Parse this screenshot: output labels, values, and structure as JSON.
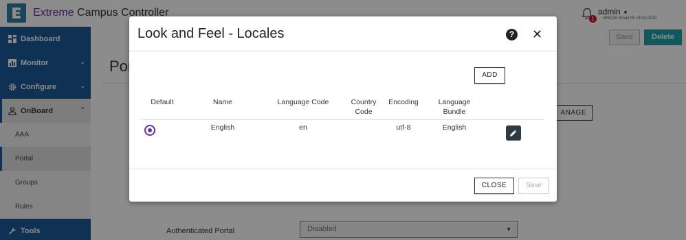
{
  "header": {
    "app_title_prefix": "Extreme",
    "app_title_suffix": " Campus Controller",
    "notification_count": "1",
    "user_name": "admin",
    "user_sub": "VE6120 Small 05.16.02.0020"
  },
  "sidebar": {
    "items": [
      {
        "label": "Dashboard"
      },
      {
        "label": "Monitor"
      },
      {
        "label": "Configure"
      },
      {
        "label": "OnBoard"
      },
      {
        "label": "AAA"
      },
      {
        "label": "Portal"
      },
      {
        "label": "Groups"
      },
      {
        "label": "Rules"
      },
      {
        "label": "Tools"
      }
    ]
  },
  "page": {
    "save_label": "Save",
    "delete_label": "Delete",
    "title": "Por",
    "manage_label": "ANAGE",
    "auth_portal_label": "Authenticated Portal",
    "auth_portal_value": "Disabled"
  },
  "modal": {
    "title": "Look and Feel - Locales",
    "help_glyph": "?",
    "close_glyph": "✕",
    "add_label": "ADD",
    "columns": {
      "default": "Default",
      "name": "Name",
      "language_code": "Language Code",
      "country_code_1": "Country",
      "country_code_2": "Code",
      "encoding": "Encoding",
      "language_bundle_1": "Language",
      "language_bundle_2": "Bundle"
    },
    "row": {
      "name": "English",
      "language_code": "en",
      "country_code": "",
      "encoding": "utf-8",
      "language_bundle": "English"
    },
    "close_label": "CLOSE",
    "save_label": "Save"
  },
  "colors": {
    "brand_blue": "#1b5a9a",
    "accent_purple": "#6b2ea0",
    "delete_teal": "#1aa3a9"
  }
}
